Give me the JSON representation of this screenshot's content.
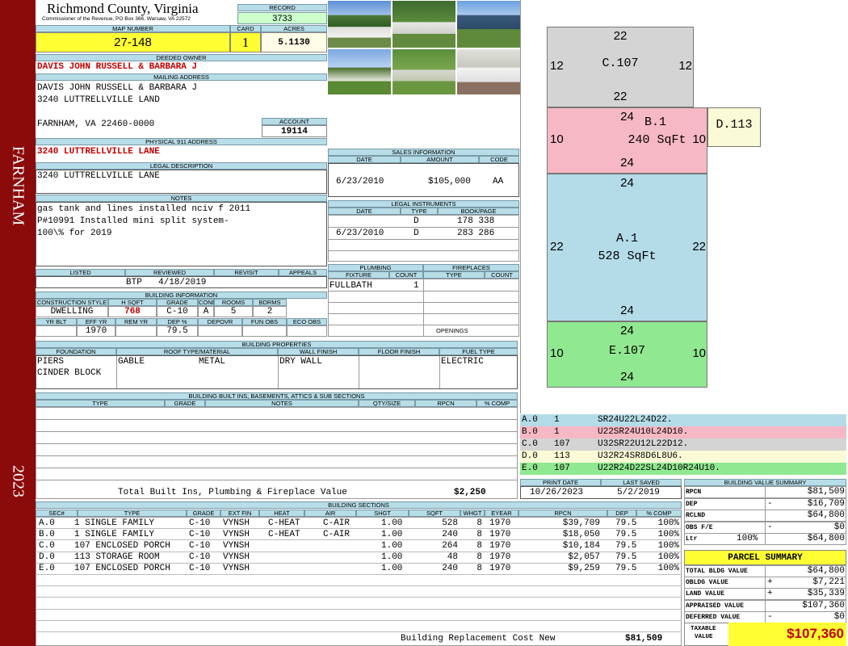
{
  "sidebar": {
    "city": "FARNHAM",
    "year": "2023"
  },
  "county": {
    "name": "Richmond County, Virginia",
    "subtitle": "Commissioner of the Revenue, PO Box 366, Warsaw, VA 22572"
  },
  "record": {
    "label": "RECORD",
    "value": "3733"
  },
  "map": {
    "label": "MAP NUMBER",
    "value": "27-148",
    "card_label": "CARD",
    "card": "1",
    "acres_label": "ACRES",
    "acres": "5.1130"
  },
  "owner": {
    "label": "DEEDED OWNER",
    "value": "DAVIS JOHN RUSSELL & BARBARA J"
  },
  "mailing": {
    "label": "MAILING ADDRESS",
    "line1": "DAVIS JOHN RUSSELL & BARBARA J",
    "line2": "3240 LUTTRELLVILLE LAND",
    "line3": "FARNHAM, VA 22460-0000"
  },
  "account": {
    "label": "ACCOUNT",
    "value": "19114"
  },
  "physical": {
    "label": "PHYSICAL 911 ADDRESS",
    "value": "3240 LUTTRELLVILLE LANE"
  },
  "legal": {
    "label": "LEGAL DESCRIPTION",
    "value": "3240 LUTTRELLVILLE LANE"
  },
  "notes": {
    "label": "NOTES",
    "line1": "gas tank and lines installed nciv f 2011",
    "line2": "P#10991 Installed mini split system-",
    "line3": "100\\% for 2019"
  },
  "listing": {
    "listed_label": "LISTED",
    "reviewed_label": "REVIEWED",
    "revisit_label": "REVISIT",
    "appeals_label": "APPEALS",
    "reviewer": "BTP",
    "reviewed": "4/18/2019"
  },
  "building_info": {
    "label": "BUILDING INFORMATION",
    "h": [
      "CONSTRUCTION STYLE",
      "H SQFT",
      "GRADE",
      "COND",
      "ROOMS",
      "BDRMS"
    ],
    "v": [
      "DWELLING",
      "768",
      "C-10",
      "A",
      "5",
      "2"
    ],
    "h2": [
      "YR BLT",
      "EFF YR",
      "REM YR",
      "DEP %",
      "DEPOVR",
      "FUN OBS",
      "ECO OBS"
    ],
    "v2": [
      "",
      "1970",
      "",
      "79.5",
      "",
      "",
      ""
    ]
  },
  "properties": {
    "label": "BUILDING PROPERTIES",
    "h": [
      "FOUNDATION",
      "ROOF TYPE/MATERIAL",
      "WALL FINISH",
      "FLOOR FINISH",
      "FUEL TYPE"
    ],
    "foundation1": "PIERS",
    "foundation2": "CINDER BLOCK",
    "roof_type": "GABLE",
    "roof_mat": "METAL",
    "wall": "DRY WALL",
    "fuel": "ELECTRIC"
  },
  "builtins": {
    "label": "BUILDING BUILT INS, BASEMENTS, ATTICS & SUB SECTIONS",
    "h": [
      "TYPE",
      "GRADE",
      "NOTES",
      "QTY/SIZE",
      "RPCN",
      "% COMP"
    ]
  },
  "total_builtins": {
    "label": "Total Built Ins, Plumbing & Fireplace Value",
    "value": "$2,250"
  },
  "sales": {
    "label": "SALES INFORMATION",
    "h": [
      "DATE",
      "AMOUNT",
      "CODE"
    ],
    "date": "6/23/2010",
    "amount": "$105,000",
    "code": "AA"
  },
  "instruments": {
    "label": "LEGAL INSTRUMENTS",
    "h": [
      "DATE",
      "TYPE",
      "BOOK/PAGE"
    ],
    "rows": [
      [
        "",
        "D",
        "178 338"
      ],
      [
        "6/23/2010",
        "D",
        "283 286"
      ]
    ]
  },
  "plumbing": {
    "label": "PLUMBING",
    "h": [
      "FIXTURE",
      "COUNT"
    ],
    "fixture": "FULLBATH",
    "count": "1"
  },
  "fireplaces": {
    "label": "FIREPLACES",
    "h": [
      "TYPE",
      "COUNT"
    ],
    "openings": "OPENINGS"
  },
  "sketch": {
    "sections": [
      {
        "label": "C.107",
        "top": "22",
        "bottom": "22",
        "left": "12",
        "right": "12",
        "sqft": ""
      },
      {
        "label": "B.1",
        "top": "24",
        "bottom": "24",
        "left": "10",
        "right": "10",
        "sqft": "240 SqFt"
      },
      {
        "label": "A.1",
        "top": "24",
        "bottom": "24",
        "left": "22",
        "right": "22",
        "sqft": "528 SqFt"
      },
      {
        "label": "E.107",
        "top": "24",
        "bottom": "24",
        "left": "10",
        "right": "10",
        "sqft": ""
      },
      {
        "label": "D.113"
      }
    ],
    "legend": [
      {
        "sec": "A.0",
        "n": "1",
        "code": "SR24U22L24D22.",
        "color": "#b4dce8"
      },
      {
        "sec": "B.0",
        "n": "1",
        "code": "U22SR24U10L24D10.",
        "color": "#f6b8c4"
      },
      {
        "sec": "C.0",
        "n": "107",
        "code": "U32SR22U12L22D12.",
        "color": "#d4d4d4"
      },
      {
        "sec": "D.0",
        "n": "113",
        "code": "U32R24SR8D6L8U6.",
        "color": "#fafad6"
      },
      {
        "sec": "E.0",
        "n": "107",
        "code": "U22R24D22SL24D10R24U10.",
        "color": "#90e890"
      }
    ]
  },
  "print": {
    "print_label": "PRINT DATE",
    "saved_label": "LAST SAVED",
    "print_date": "10/26/2023",
    "last_saved": "5/2/2019"
  },
  "sections": {
    "label": "BUILDING SECTIONS",
    "h": [
      "SEC#",
      "TYPE",
      "GRADE",
      "EXT FIN",
      "HEAT",
      "AIR",
      "SHGT",
      "SQFT",
      "WHGT",
      "EYEAR",
      "RPCN",
      "DEP",
      "% COMP"
    ],
    "rows": [
      [
        "A.0",
        "1 SINGLE FAMILY",
        "C-10",
        "VYNSH",
        "C-HEAT",
        "C-AIR",
        "1.00",
        "528",
        "8",
        "1970",
        "$39,709",
        "79.5",
        "100%"
      ],
      [
        "B.0",
        "1 SINGLE FAMILY",
        "C-10",
        "VYNSH",
        "C-HEAT",
        "C-AIR",
        "1.00",
        "240",
        "8",
        "1970",
        "$18,050",
        "79.5",
        "100%"
      ],
      [
        "C.0",
        "107 ENCLOSED PORCH",
        "C-10",
        "VYNSH",
        "",
        "",
        "1.00",
        "264",
        "8",
        "1970",
        "$10,184",
        "79.5",
        "100%"
      ],
      [
        "D.0",
        "113 STORAGE ROOM",
        "C-10",
        "VYNSH",
        "",
        "",
        "1.00",
        "48",
        "8",
        "1970",
        "$2,057",
        "79.5",
        "100%"
      ],
      [
        "E.0",
        "107 ENCLOSED PORCH",
        "C-10",
        "VYNSH",
        "",
        "",
        "1.00",
        "240",
        "8",
        "1970",
        "$9,259",
        "79.5",
        "100%"
      ]
    ],
    "total_label": "Building Replacement Cost New",
    "total": "$81,509"
  },
  "value_summary": {
    "label": "BUILDING VALUE SUMMARY",
    "rows": [
      {
        "k": "RPCN",
        "s": "",
        "v": "$81,509"
      },
      {
        "k": "DEP",
        "s": "-",
        "v": "$16,709"
      },
      {
        "k": "RCLND",
        "s": "",
        "v": "$64,800"
      },
      {
        "k": "OBS F/E",
        "s": "-",
        "v": "$0"
      },
      {
        "k": "Ltr",
        "s": "",
        "v": "$64,800",
        "pct": "100%"
      }
    ]
  },
  "parcel": {
    "title": "PARCEL SUMMARY",
    "rows": [
      {
        "k": "TOTAL BLDG VALUE",
        "s": "",
        "v": "$64,800"
      },
      {
        "k": "OBLDG VALUE",
        "s": "+",
        "v": "$7,221"
      },
      {
        "k": "LAND VALUE",
        "s": "+",
        "v": "$35,339"
      },
      {
        "k": "APPRAISED VALUE",
        "s": "",
        "v": "$107,360"
      },
      {
        "k": "DEFERRED VALUE",
        "s": "-",
        "v": "$0"
      }
    ],
    "taxable_label1": "TAXABLE",
    "taxable_label2": "VALUE",
    "taxable": "$107,360"
  },
  "colors": {
    "sidebar": "#8b0a0a",
    "header": "#b7dde8",
    "yellow": "#ffff33",
    "green": "#ccffcc",
    "red": "#c00000"
  }
}
